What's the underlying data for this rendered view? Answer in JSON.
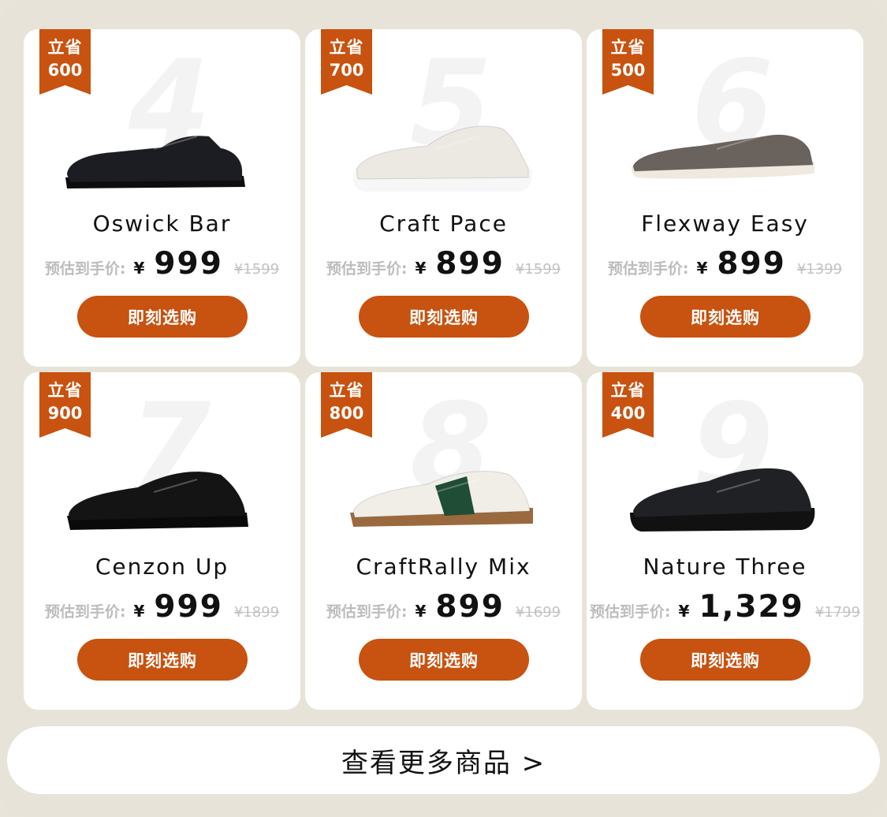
{
  "products": [
    {
      "badge_top": "立省",
      "badge_value": "600",
      "watermark": "4",
      "name": "Oswick Bar",
      "price_label": "预估到手价:",
      "currency": "¥",
      "price": "999",
      "original_price": "¥1599",
      "button": "即刻选购",
      "shoe_color": "#1b1d22",
      "sole_color": "#0d0d0d",
      "style": "loafer"
    },
    {
      "badge_top": "立省",
      "badge_value": "700",
      "watermark": "5",
      "name": "Craft Pace",
      "price_label": "预估到手价:",
      "currency": "¥",
      "price": "899",
      "original_price": "¥1599",
      "button": "即刻选购",
      "shoe_color": "#ece8e2",
      "sole_color": "#f7f7f7",
      "style": "sneaker"
    },
    {
      "badge_top": "立省",
      "badge_value": "500",
      "watermark": "6",
      "name": "Flexway Easy",
      "price_label": "预估到手价:",
      "currency": "¥",
      "price": "899",
      "original_price": "¥1399",
      "button": "即刻选购",
      "shoe_color": "#6a625c",
      "sole_color": "#efe9df",
      "style": "slipon"
    },
    {
      "badge_top": "立省",
      "badge_value": "900",
      "watermark": "7",
      "name": "Cenzon Up",
      "price_label": "预估到手价:",
      "currency": "¥",
      "price": "999",
      "original_price": "¥1899",
      "button": "即刻选购",
      "shoe_color": "#141414",
      "sole_color": "#0a0a0a",
      "style": "derby"
    },
    {
      "badge_top": "立省",
      "badge_value": "800",
      "watermark": "8",
      "name": "CraftRally Mix",
      "price_label": "预估到手价:",
      "currency": "¥",
      "price": "899",
      "original_price": "¥1699",
      "button": "即刻选购",
      "shoe_color": "#f1eee8",
      "sole_color": "#9a6a3e",
      "style": "court",
      "accent": "#1f4d36"
    },
    {
      "badge_top": "立省",
      "badge_value": "400",
      "watermark": "9",
      "name": "Nature Three",
      "price_label": "预估到手价:",
      "currency": "¥",
      "price": "1,329",
      "original_price": "¥1799",
      "button": "即刻选购",
      "shoe_color": "#202124",
      "sole_color": "#111111",
      "style": "walker"
    }
  ],
  "more_button": "查看更多商品 >",
  "colors": {
    "accent": "#c8520f",
    "background": "#e8e3d9",
    "card": "#ffffff"
  }
}
